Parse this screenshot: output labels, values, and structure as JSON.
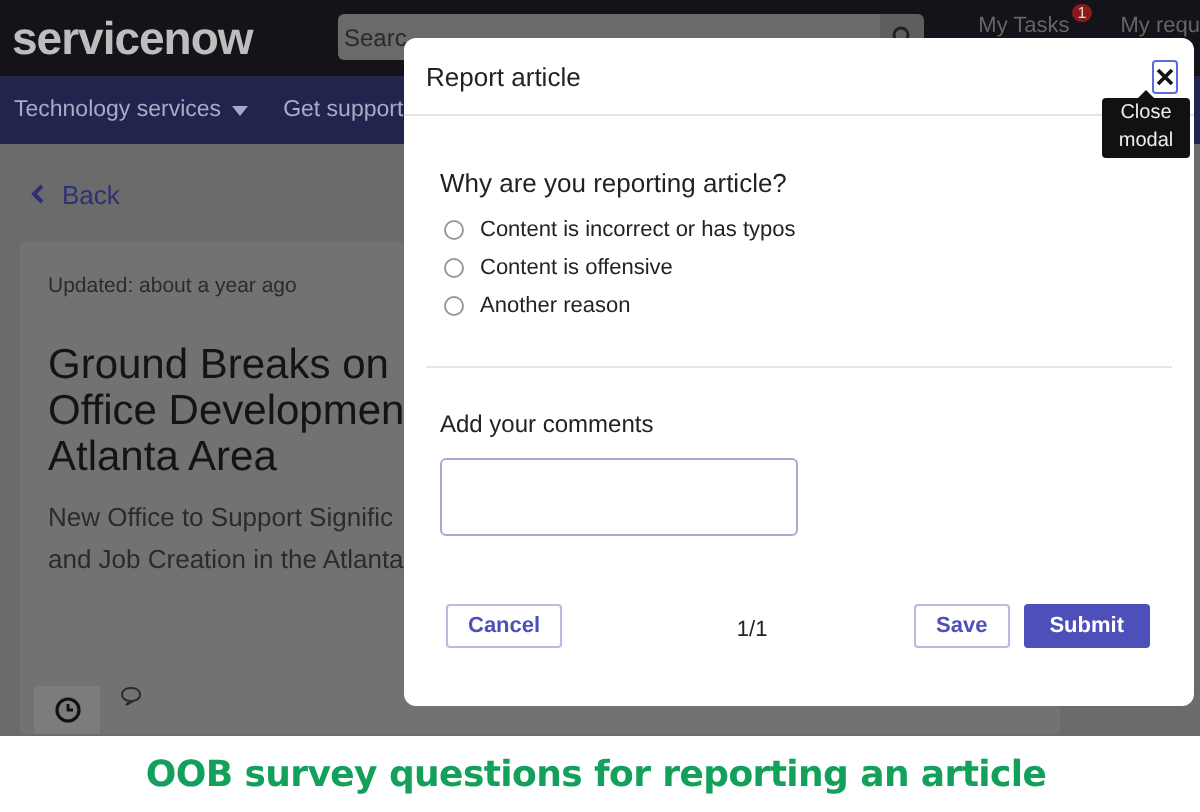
{
  "header": {
    "logo": "servicenow",
    "search": {
      "placeholder": "Searc"
    },
    "links": [
      {
        "label": "My Tasks",
        "badge": "1"
      },
      {
        "label": "My requ"
      }
    ]
  },
  "nav": {
    "items": [
      {
        "label": "Technology services",
        "dropdown": true
      },
      {
        "label": "Get support",
        "dropdown": false
      }
    ]
  },
  "back": "Back",
  "article": {
    "updated": "Updated: about a year ago",
    "title_lines": [
      "Ground Breaks on",
      "Office Developmen",
      "Atlanta Area"
    ],
    "subtitle_lines": [
      "New Office to Support Signific",
      "and Job Creation in the Atlanta"
    ]
  },
  "modal": {
    "title": "Report article",
    "close_tooltip": "Close modal",
    "question": "Why are you reporting article?",
    "options": [
      {
        "label": "Content is incorrect or has typos",
        "selected": false
      },
      {
        "label": "Content is offensive",
        "selected": false
      },
      {
        "label": "Another reason",
        "selected": false
      }
    ],
    "comments_label": "Add your comments",
    "cancel": "Cancel",
    "page": "1/1",
    "save": "Save",
    "submit": "Submit"
  },
  "caption": "OOB survey questions for reporting an article"
}
